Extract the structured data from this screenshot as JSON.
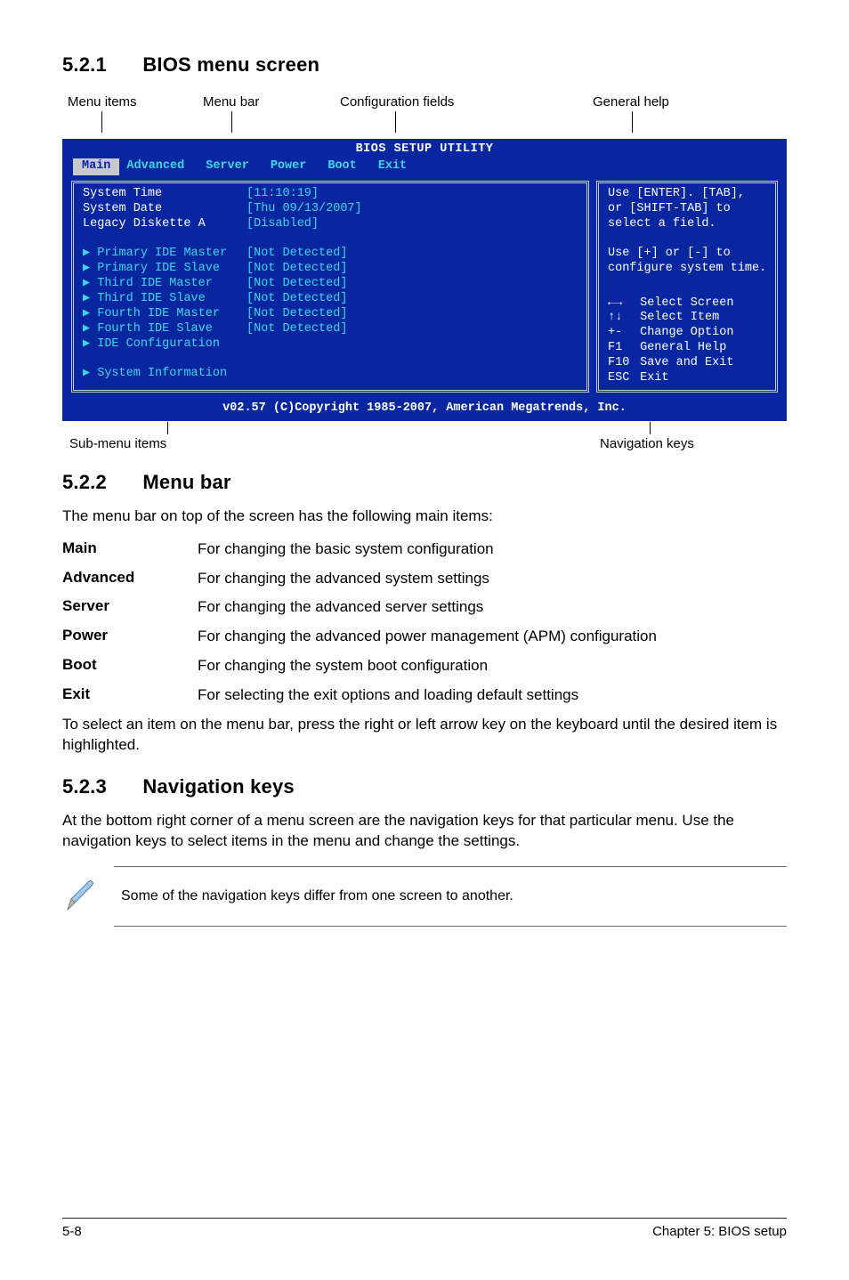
{
  "sections": {
    "s521_no": "5.2.1",
    "s521_title": "BIOS menu screen",
    "s522_no": "5.2.2",
    "s522_title": "Menu bar",
    "s523_no": "5.2.3",
    "s523_title": "Navigation keys"
  },
  "callouts": {
    "menu_items": "Menu items",
    "menu_bar": "Menu bar",
    "config_fields": "Configuration fields",
    "general_help": "General help",
    "submenu": "Sub-menu items",
    "navkeys": "Navigation keys"
  },
  "bios": {
    "title": "BIOS SETUP UTILITY",
    "tabs": [
      "Main",
      "Advanced",
      "Server",
      "Power",
      "Boot",
      "Exit"
    ],
    "left_labels": [
      "System Time",
      "System Date",
      "Legacy Diskette A",
      "",
      "Primary IDE Master",
      "Primary IDE Slave",
      "Third IDE Master",
      "Third IDE Slave",
      "Fourth IDE Master",
      "Fourth IDE Slave",
      "IDE Configuration",
      "",
      "System Information"
    ],
    "left_arrow_rows": [
      4,
      5,
      6,
      7,
      8,
      9,
      10,
      12
    ],
    "left_values": [
      "[11:10:19]",
      "[Thu 09/13/2007]",
      "[Disabled]",
      "",
      "[Not Detected]",
      "[Not Detected]",
      "[Not Detected]",
      "[Not Detected]",
      "[Not Detected]",
      "[Not Detected]"
    ],
    "help_lines": [
      "Use [ENTER]. [TAB],",
      "or [SHIFT-TAB] to",
      "select a field.",
      "",
      "Use [+] or [-] to",
      "configure system time."
    ],
    "nav": [
      {
        "sym": "←→",
        "txt": "Select Screen"
      },
      {
        "sym": "↑↓",
        "txt": "Select Item"
      },
      {
        "sym": "+-",
        "txt": "Change Option"
      },
      {
        "sym": "F1",
        "txt": "General Help"
      },
      {
        "sym": "F10",
        "txt": "Save and Exit"
      },
      {
        "sym": "ESC",
        "txt": "Exit"
      }
    ],
    "footer": "v02.57 (C)Copyright 1985-2007, American Megatrends, Inc."
  },
  "menubar_intro": "The menu bar on top of the screen has the following main items:",
  "menubar": [
    {
      "k": "Main",
      "v": "For changing the basic system configuration"
    },
    {
      "k": "Advanced",
      "v": "For changing the advanced system settings"
    },
    {
      "k": "Server",
      "v": "For changing the advanced server settings"
    },
    {
      "k": "Power",
      "v": "For changing the advanced power management (APM) configuration"
    },
    {
      "k": "Boot",
      "v": "For changing the system boot configuration"
    },
    {
      "k": "Exit",
      "v": "For selecting the exit options and loading default settings"
    }
  ],
  "menubar_outro": "To select an item on the menu bar, press the right or left arrow key on the keyboard until the desired item is highlighted.",
  "navkeys_body": "At the bottom right corner of a menu screen are the navigation keys for that particular menu. Use the navigation keys to select items in the menu and change the settings.",
  "note": "Some of the navigation keys differ from one screen to another.",
  "footer": {
    "left": "5-8",
    "right": "Chapter 5: BIOS setup"
  }
}
